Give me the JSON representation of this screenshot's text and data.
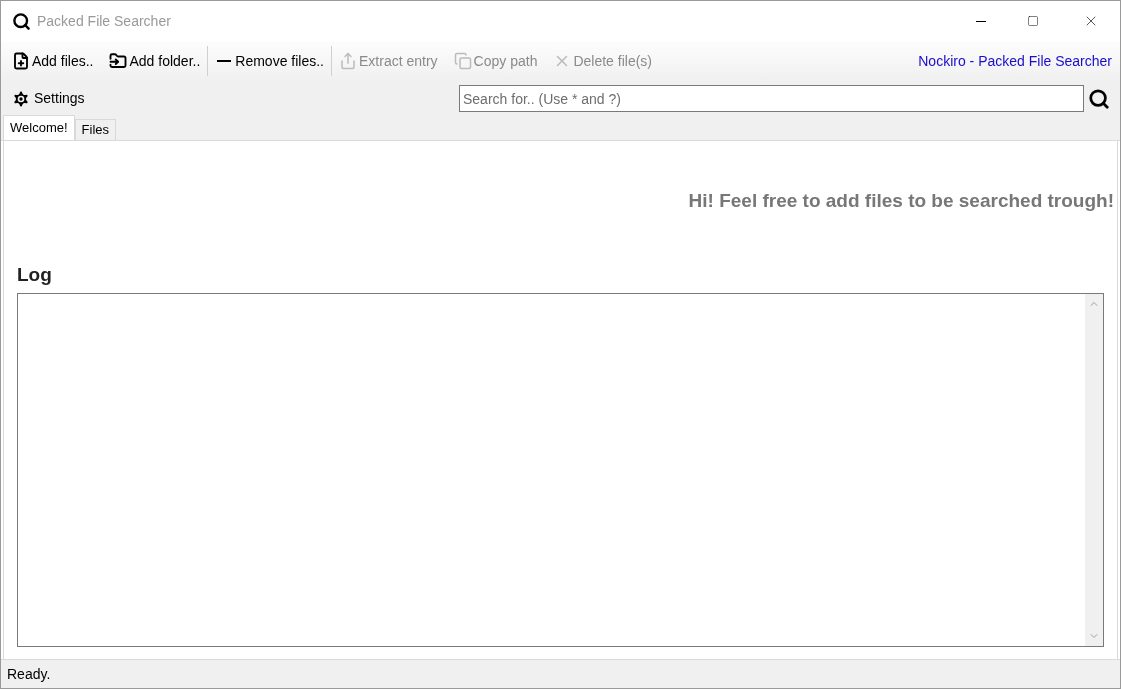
{
  "window": {
    "title": "Packed File Searcher"
  },
  "toolbar": {
    "items": [
      {
        "label": "Add files..",
        "disabled": false,
        "separator_after": false
      },
      {
        "label": "Add folder..",
        "disabled": false,
        "separator_after": true
      },
      {
        "label": "Remove files..",
        "disabled": false,
        "separator_after": true
      },
      {
        "label": "Extract entry",
        "disabled": true,
        "separator_after": false
      },
      {
        "label": "Copy path",
        "disabled": true,
        "separator_after": false
      },
      {
        "label": "Delete file(s)",
        "disabled": true,
        "separator_after": false
      }
    ],
    "link": "Nockiro - Packed File Searcher"
  },
  "settings": {
    "label": "Settings"
  },
  "search": {
    "placeholder": "Search for.. (Use * and ?)"
  },
  "tabs": [
    {
      "label": "Welcome!",
      "selected": true
    },
    {
      "label": "Files",
      "selected": false
    }
  ],
  "welcome": {
    "message": "Hi! Feel free to add files to be searched trough!"
  },
  "log": {
    "title": "Log"
  },
  "status_bar": {
    "text": "Ready."
  }
}
